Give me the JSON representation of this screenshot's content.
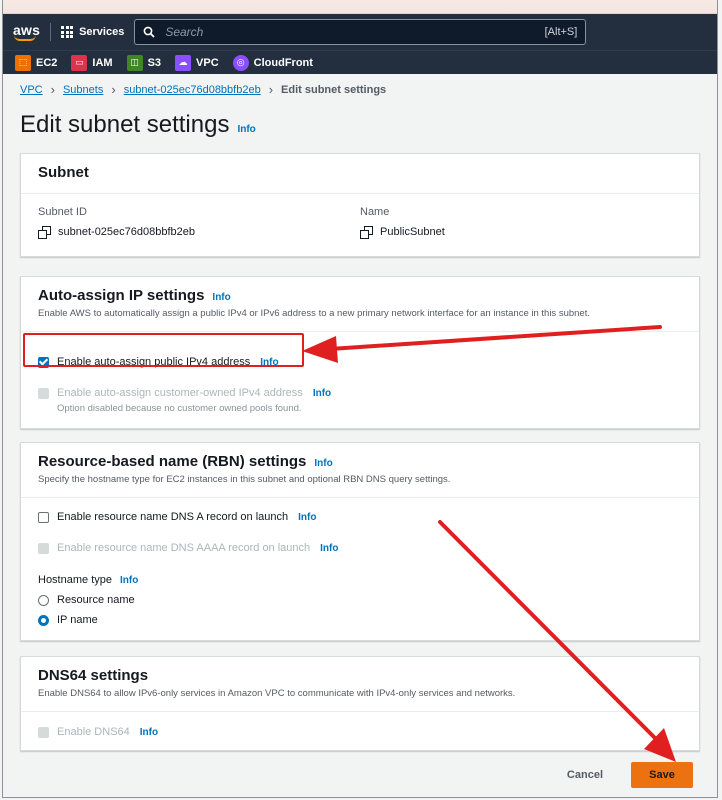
{
  "header": {
    "logo": "aws",
    "services_label": "Services",
    "search_placeholder": "Search",
    "search_shortcut": "[Alt+S]"
  },
  "favorites": [
    {
      "label": "EC2",
      "color": "#ed7100",
      "icon": "ec2-icon"
    },
    {
      "label": "IAM",
      "color": "#dd344c",
      "icon": "iam-icon"
    },
    {
      "label": "S3",
      "color": "#3f8624",
      "icon": "s3-icon"
    },
    {
      "label": "VPC",
      "color": "#8c4fff",
      "icon": "vpc-icon"
    },
    {
      "label": "CloudFront",
      "color": "#8c4fff",
      "icon": "cloudfront-icon"
    }
  ],
  "breadcrumb": {
    "items": [
      "VPC",
      "Subnets",
      "subnet-025ec76d08bbfb2eb"
    ],
    "current": "Edit subnet settings"
  },
  "page": {
    "title": "Edit subnet settings",
    "info": "Info"
  },
  "subnet_panel": {
    "title": "Subnet",
    "id_label": "Subnet ID",
    "id_value": "subnet-025ec76d08bbfb2eb",
    "name_label": "Name",
    "name_value": "PublicSubnet"
  },
  "auto_assign": {
    "title": "Auto-assign IP settings",
    "info": "Info",
    "description": "Enable AWS to automatically assign a public IPv4 or IPv6 address to a new primary network interface for an instance in this subnet.",
    "ipv4_label": "Enable auto-assign public IPv4 address",
    "ipv4_checked": true,
    "ipv4_info": "Info",
    "customer_owned_label": "Enable auto-assign customer-owned IPv4 address",
    "customer_owned_info": "Info",
    "customer_owned_hint": "Option disabled because no customer owned pools found."
  },
  "rbn": {
    "title": "Resource-based name (RBN) settings",
    "info": "Info",
    "description": "Specify the hostname type for EC2 instances in this subnet and optional RBN DNS query settings.",
    "dns_a_label": "Enable resource name DNS A record on launch",
    "dns_a_info": "Info",
    "dns_aaaa_label": "Enable resource name DNS AAAA record on launch",
    "dns_aaaa_info": "Info",
    "hostname_label": "Hostname type",
    "hostname_info": "Info",
    "options": [
      "Resource name",
      "IP name"
    ],
    "selected": "IP name"
  },
  "dns64": {
    "title": "DNS64 settings",
    "description": "Enable DNS64 to allow IPv6-only services in Amazon VPC to communicate with IPv4-only services and networks.",
    "enable_label": "Enable DNS64",
    "enable_info": "Info"
  },
  "actions": {
    "cancel": "Cancel",
    "save": "Save"
  },
  "colors": {
    "nav_bg": "#232f3e",
    "link": "#0073bb",
    "primary_button": "#ec7211",
    "annotation": "#e02020"
  }
}
